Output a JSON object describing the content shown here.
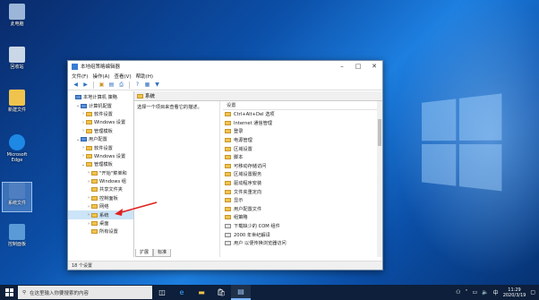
{
  "desktop": {
    "icons": [
      {
        "label": "此电脑",
        "color": "#9bb6d8"
      },
      {
        "label": "回收站",
        "color": "#c9d7e6"
      },
      {
        "label": "新建文件",
        "color": "#f0c44c"
      },
      {
        "label": "Microsoft Edge",
        "color": "#1e88e5"
      },
      {
        "label": "系统文件",
        "color": "#4f7fc0"
      },
      {
        "label": "控制面板",
        "color": "#5a9ad6"
      }
    ]
  },
  "window": {
    "title": "本地组策略编辑器",
    "menu": [
      "文件(F)",
      "操作(A)",
      "查看(V)",
      "帮助(H)"
    ],
    "tree": [
      {
        "label": "本地计算机 策略",
        "indent": 0,
        "exp": "",
        "root": true
      },
      {
        "label": "计算机配置",
        "indent": 1,
        "exp": "⌄",
        "root": true
      },
      {
        "label": "软件设置",
        "indent": 2,
        "exp": "›"
      },
      {
        "label": "Windows 设置",
        "indent": 2,
        "exp": "›"
      },
      {
        "label": "管理模板",
        "indent": 2,
        "exp": "›"
      },
      {
        "label": "用户配置",
        "indent": 1,
        "exp": "⌄",
        "root": true
      },
      {
        "label": "软件设置",
        "indent": 2,
        "exp": "›"
      },
      {
        "label": "Windows 设置",
        "indent": 2,
        "exp": "›"
      },
      {
        "label": "管理模板",
        "indent": 2,
        "exp": "⌄"
      },
      {
        "label": "\"开始\"菜单和",
        "indent": 3,
        "exp": "›"
      },
      {
        "label": "Windows 组",
        "indent": 3,
        "exp": "›"
      },
      {
        "label": "共享文件夹",
        "indent": 3,
        "exp": ""
      },
      {
        "label": "控制面板",
        "indent": 3,
        "exp": "›"
      },
      {
        "label": "网络",
        "indent": 3,
        "exp": "›"
      },
      {
        "label": "系统",
        "indent": 3,
        "exp": "›",
        "selected": true
      },
      {
        "label": "桌面",
        "indent": 3,
        "exp": "›"
      },
      {
        "label": "所有设置",
        "indent": 3,
        "exp": ""
      }
    ],
    "right_header": "系统",
    "description": "选择一个项目来查看它的描述。",
    "column_header": "设置",
    "items": [
      "Ctrl+Alt+Del 选项",
      "Internet 通信管理",
      "登录",
      "电源管理",
      "区域设置",
      "脚本",
      "可移动存储访问",
      "区域设置服务",
      "驱动程序安装",
      "文件夹重定向",
      "显示",
      "用户配置文件",
      "组策略",
      "下载缺少的 COM 组件",
      "2000 年世纪解译",
      "用户 以便传换浏览器访问"
    ],
    "tabs": [
      "扩展",
      "标准"
    ],
    "status": "18 个设置"
  },
  "taskbar": {
    "search_placeholder": "在这里输入你要搜索的内容",
    "time": "11:29",
    "date": "2020/3/19",
    "lang": "中"
  }
}
